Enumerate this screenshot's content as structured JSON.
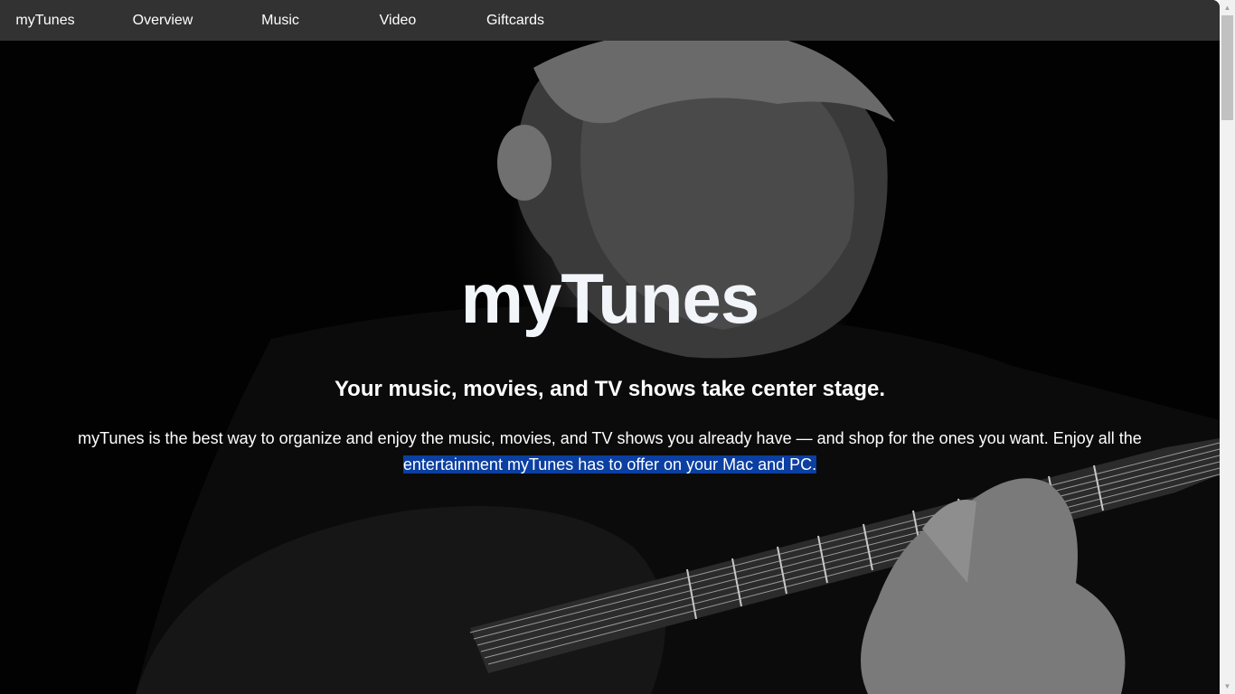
{
  "nav": {
    "brand": "myTunes",
    "items": [
      {
        "label": "Overview"
      },
      {
        "label": "Music"
      },
      {
        "label": "Video"
      },
      {
        "label": "Giftcards"
      }
    ]
  },
  "hero": {
    "title": "myTunes",
    "subtitle": "Your music, movies, and TV shows take center stage.",
    "body_line1": "myTunes is the best way to organize and enjoy the music, movies, and TV shows you already have — and shop for the ones you want. Enjoy all the",
    "body_line2_selected": "entertainment myTunes has to offer on your Mac and PC."
  },
  "scrollbar": {
    "up_icon": "scroll-up-arrow-icon",
    "down_icon": "scroll-down-arrow-icon"
  },
  "colors": {
    "navbar_bg": "#333232",
    "page_bg": "#000000",
    "selection_bg": "#0b3fa1"
  }
}
